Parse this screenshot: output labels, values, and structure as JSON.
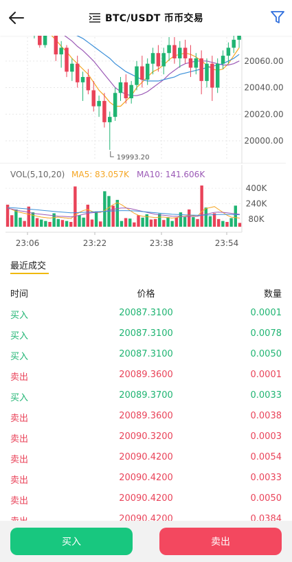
{
  "header": {
    "title": "BTC/USDT 币币交易",
    "back_icon": "arrow-left-icon",
    "menu_icon": "list-icon",
    "filter_icon": "filter-icon",
    "filter_color": "#2f6fdd"
  },
  "colors": {
    "up": "#1fb472",
    "down": "#e94359",
    "ma5": "#f5a623",
    "ma10": "#9b59b6",
    "ma20": "#3a8fd9",
    "accent": "#f0b90b"
  },
  "chart_data": [
    {
      "type": "candlestick",
      "price_axis_labels": [
        "20060.00",
        "20040.00",
        "20020.00",
        "20000.00"
      ],
      "price_ticks": [
        20060,
        20040,
        20020,
        20000
      ],
      "ylim": [
        19985,
        20078
      ],
      "low_annotation": "19993.20",
      "low_value": 19993.2,
      "candles": [
        [
          20080,
          20090,
          20077,
          20085
        ],
        [
          20085,
          20088,
          20070,
          20072
        ],
        [
          20072,
          20090,
          20070,
          20088
        ],
        [
          20088,
          20092,
          20080,
          20083
        ],
        [
          20083,
          20085,
          20060,
          20065
        ],
        [
          20065,
          20075,
          20055,
          20070
        ],
        [
          20070,
          20072,
          20048,
          20052
        ],
        [
          20052,
          20062,
          20045,
          20058
        ],
        [
          20058,
          20064,
          20040,
          20044
        ],
        [
          20044,
          20052,
          20030,
          20048
        ],
        [
          20048,
          20054,
          20035,
          20038
        ],
        [
          20038,
          20045,
          20022,
          20026
        ],
        [
          20026,
          20034,
          20018,
          20030
        ],
        [
          20030,
          20036,
          20010,
          20014
        ],
        [
          20014,
          20022,
          19993.2,
          20018
        ],
        [
          20018,
          20040,
          20015,
          20036
        ],
        [
          20036,
          20048,
          20030,
          20044
        ],
        [
          20044,
          20050,
          20028,
          20032
        ],
        [
          20032,
          20045,
          20028,
          20042
        ],
        [
          20042,
          20060,
          20038,
          20056
        ],
        [
          20056,
          20064,
          20040,
          20046
        ],
        [
          20046,
          20062,
          20042,
          20058
        ],
        [
          20058,
          20070,
          20050,
          20066
        ],
        [
          20066,
          20072,
          20052,
          20056
        ],
        [
          20056,
          20070,
          20050,
          20066
        ],
        [
          20066,
          20078,
          20060,
          20072
        ],
        [
          20072,
          20078,
          20058,
          20062
        ],
        [
          20062,
          20075,
          20055,
          20070
        ],
        [
          20070,
          20076,
          20058,
          20062
        ],
        [
          20062,
          20072,
          20048,
          20055
        ],
        [
          20055,
          20066,
          20050,
          20062
        ],
        [
          20062,
          20068,
          20035,
          20045
        ],
        [
          20045,
          20062,
          20040,
          20058
        ],
        [
          20058,
          20064,
          20030,
          20040
        ],
        [
          20040,
          20062,
          20036,
          20058
        ],
        [
          20058,
          20068,
          20054,
          20064
        ],
        [
          20064,
          20074,
          20058,
          20070
        ],
        [
          20070,
          20080,
          20066,
          20076
        ],
        [
          20076,
          20086,
          20070,
          20082
        ]
      ],
      "ma_series": [
        {
          "color_key": "ma5",
          "values": [
            20086,
            20084,
            20082,
            20080,
            20076,
            20071,
            20067,
            20062,
            20058,
            20054,
            20050,
            20044,
            20038,
            20034,
            20029,
            20026,
            20026,
            20030,
            20034,
            20040,
            20044,
            20048,
            20052,
            20054,
            20057,
            20061,
            20064,
            20065,
            20066,
            20065,
            20063,
            20060,
            20057,
            20054,
            20053,
            20054,
            20058,
            20064,
            20070
          ]
        },
        {
          "color_key": "ma10",
          "values": [
            20088,
            20087,
            20086,
            20085,
            20083,
            20081,
            20078,
            20075,
            20071,
            20068,
            20064,
            20060,
            20055,
            20050,
            20045,
            20040,
            20037,
            20035,
            20034,
            20034,
            20035,
            20037,
            20040,
            20043,
            20046,
            20050,
            20053,
            20056,
            20058,
            20059,
            20060,
            20060,
            20060,
            20059,
            20058,
            20057,
            20057,
            20058,
            20060
          ]
        },
        {
          "color_key": "ma20",
          "values": [
            20090,
            20089,
            20088,
            20087,
            20086,
            20085,
            20083,
            20081,
            20079,
            20077,
            20074,
            20071,
            20068,
            20065,
            20062,
            20058,
            20055,
            20052,
            20050,
            20048,
            20046,
            20045,
            20045,
            20045,
            20046,
            20047,
            20048,
            20050,
            20051,
            20052,
            20053,
            20054,
            20055,
            20056,
            20057,
            20058,
            20060,
            20062,
            20065
          ]
        }
      ]
    },
    {
      "type": "bar",
      "legend": {
        "vol": "VOL(5,10,20)",
        "ma5": "MA5: 83.057K",
        "ma10": "MA10: 141.606K"
      },
      "volume_axis_labels": [
        "400K",
        "240K",
        "80K"
      ],
      "volume_ticks": [
        400,
        240,
        80
      ],
      "ylim": [
        0,
        430
      ],
      "volumes": [
        230,
        120,
        180,
        95,
        60,
        210,
        150,
        90,
        75,
        60,
        50,
        140,
        80,
        70,
        60,
        50,
        420,
        120,
        95,
        230,
        75,
        160,
        55,
        370,
        320,
        220,
        280,
        60,
        90,
        85,
        45,
        120,
        95,
        130,
        75,
        80,
        135,
        70,
        100,
        60,
        95,
        150,
        100,
        180,
        100,
        80,
        430,
        200,
        110,
        140,
        80,
        60,
        50,
        90,
        220,
        40
      ],
      "volume_ma": [
        {
          "color_key": "ma5",
          "values": [
            200,
            180,
            160,
            150,
            140,
            130,
            120,
            110,
            100,
            95,
            90,
            95,
            100,
            95,
            90,
            85,
            120,
            150,
            170,
            180,
            160,
            150,
            150,
            170,
            200,
            230,
            250,
            230,
            200,
            170,
            140,
            120,
            110,
            105,
            100,
            95,
            100,
            100,
            95,
            90,
            95,
            105,
            110,
            120,
            115,
            110,
            160,
            190,
            200,
            210,
            180,
            150,
            120,
            100,
            95,
            90
          ]
        },
        {
          "color_key": "ma10",
          "values": [
            190,
            185,
            175,
            165,
            160,
            150,
            140,
            135,
            130,
            125,
            120,
            115,
            110,
            108,
            105,
            102,
            110,
            120,
            130,
            140,
            145,
            150,
            155,
            160,
            170,
            180,
            190,
            195,
            195,
            190,
            180,
            170,
            160,
            150,
            140,
            130,
            125,
            120,
            115,
            110,
            108,
            106,
            105,
            106,
            108,
            110,
            120,
            130,
            140,
            150,
            152,
            150,
            145,
            140,
            135,
            130
          ]
        },
        {
          "color_key": "ma20",
          "values": [
            200,
            198,
            195,
            192,
            188,
            184,
            180,
            176,
            172,
            168,
            164,
            160,
            156,
            152,
            148,
            145,
            146,
            148,
            150,
            152,
            154,
            156,
            158,
            160,
            162,
            164,
            166,
            168,
            168,
            167,
            165,
            162,
            158,
            154,
            150,
            146,
            142,
            138,
            134,
            130,
            128,
            126,
            124,
            122,
            121,
            120,
            121,
            122,
            124,
            126,
            127,
            128,
            128,
            127,
            126,
            125
          ]
        }
      ],
      "time_labels": [
        "23:06",
        "23:22",
        "23:38",
        "23:54"
      ]
    }
  ],
  "trades": {
    "section_title": "最近成交",
    "headers": {
      "time": "时间",
      "price": "价格",
      "qty": "数量"
    },
    "rows": [
      {
        "side": "买入",
        "type": "buy",
        "price": "20087.3100",
        "qty": "0.0001"
      },
      {
        "side": "买入",
        "type": "buy",
        "price": "20087.3100",
        "qty": "0.0078"
      },
      {
        "side": "买入",
        "type": "buy",
        "price": "20087.3100",
        "qty": "0.0050"
      },
      {
        "side": "卖出",
        "type": "sell",
        "price": "20089.3600",
        "qty": "0.0001"
      },
      {
        "side": "买入",
        "type": "buy",
        "price": "20089.3700",
        "qty": "0.0033"
      },
      {
        "side": "卖出",
        "type": "sell",
        "price": "20089.3600",
        "qty": "0.0038"
      },
      {
        "side": "卖出",
        "type": "sell",
        "price": "20090.3200",
        "qty": "0.0003"
      },
      {
        "side": "卖出",
        "type": "sell",
        "price": "20090.4200",
        "qty": "0.0054"
      },
      {
        "side": "卖出",
        "type": "sell",
        "price": "20090.4200",
        "qty": "0.0033"
      },
      {
        "side": "卖出",
        "type": "sell",
        "price": "20090.4200",
        "qty": "0.0050"
      },
      {
        "side": "卖出",
        "type": "sell",
        "price": "20090.4200",
        "qty": "0.0384"
      }
    ]
  },
  "actions": {
    "buy_label": "买入",
    "sell_label": "卖出"
  }
}
